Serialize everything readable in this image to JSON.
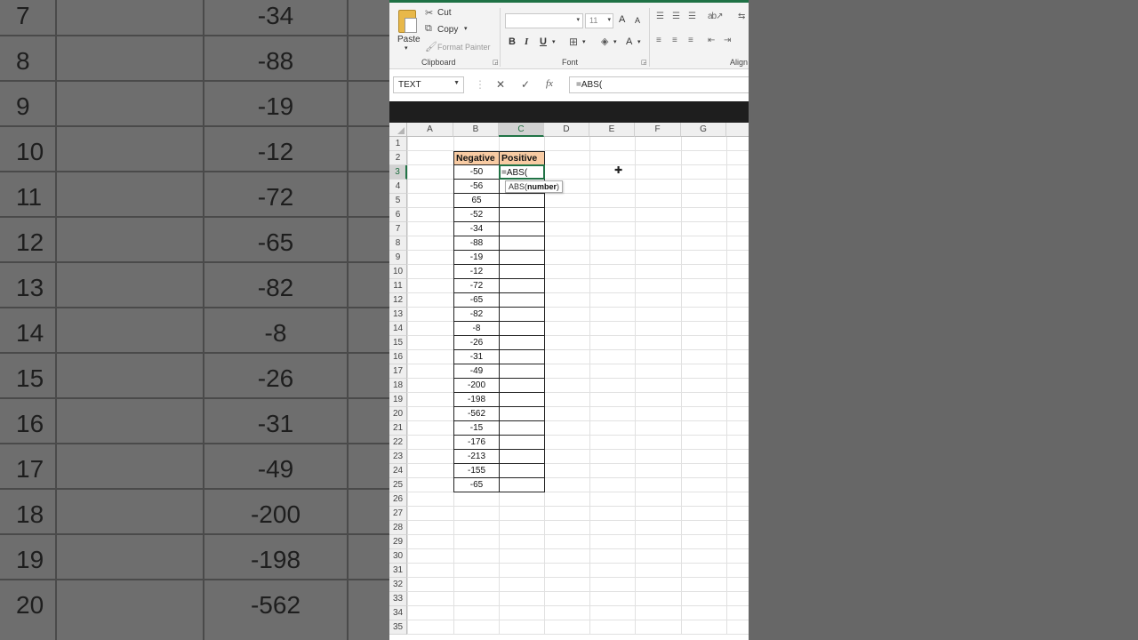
{
  "ribbon": {
    "paste_label": "Paste",
    "cut_label": "Cut",
    "copy_label": "Copy",
    "format_painter_label": "Format Painter",
    "clipboard_group": "Clipboard",
    "font_group": "Font",
    "alignment_group": "Align",
    "font_size": "11",
    "bold": "B",
    "italic": "I",
    "underline": "U",
    "grow_font": "A",
    "shrink_font": "A",
    "font_color": "A"
  },
  "formula_bar": {
    "name_box": "TEXT",
    "cancel_icon": "✕",
    "enter_icon": "✓",
    "fx_label": "fx",
    "formula": "=ABS("
  },
  "sheet": {
    "columns": [
      "A",
      "B",
      "C",
      "D",
      "E",
      "F",
      "G"
    ],
    "rows": [
      "1",
      "2",
      "3",
      "4",
      "5",
      "6",
      "7",
      "8",
      "9",
      "10",
      "11",
      "12",
      "13",
      "14",
      "15",
      "16",
      "17",
      "18",
      "19",
      "20",
      "21",
      "22",
      "23",
      "24",
      "25",
      "26",
      "27",
      "28",
      "29",
      "30",
      "31",
      "32",
      "33",
      "34",
      "35"
    ],
    "header_negative": "Negative",
    "header_positive": "Positive",
    "active_cell_text": "=ABS(",
    "tooltip_fn": "ABS(",
    "tooltip_arg": "number",
    "tooltip_close": ")",
    "negative_values": [
      "-50",
      "-56",
      "65",
      "-52",
      "-34",
      "-88",
      "-19",
      "-12",
      "-72",
      "-65",
      "-82",
      "-8",
      "-26",
      "-31",
      "-49",
      "-200",
      "-198",
      "-562",
      "-15",
      "-176",
      "-213",
      "-155",
      "-65"
    ]
  },
  "background_left": {
    "rows": [
      {
        "num": "7",
        "val": "-34"
      },
      {
        "num": "8",
        "val": "-88"
      },
      {
        "num": "9",
        "val": "-19"
      },
      {
        "num": "10",
        "val": "-12"
      },
      {
        "num": "11",
        "val": "-72"
      },
      {
        "num": "12",
        "val": "-65"
      },
      {
        "num": "13",
        "val": "-82"
      },
      {
        "num": "14",
        "val": "-8"
      },
      {
        "num": "15",
        "val": "-26"
      },
      {
        "num": "16",
        "val": "-31"
      },
      {
        "num": "17",
        "val": "-49"
      },
      {
        "num": "18",
        "val": "-200"
      },
      {
        "num": "19",
        "val": "-198"
      },
      {
        "num": "20",
        "val": "-562"
      }
    ]
  },
  "colors": {
    "accent": "#217346",
    "header_fill": "#f8cba3"
  }
}
